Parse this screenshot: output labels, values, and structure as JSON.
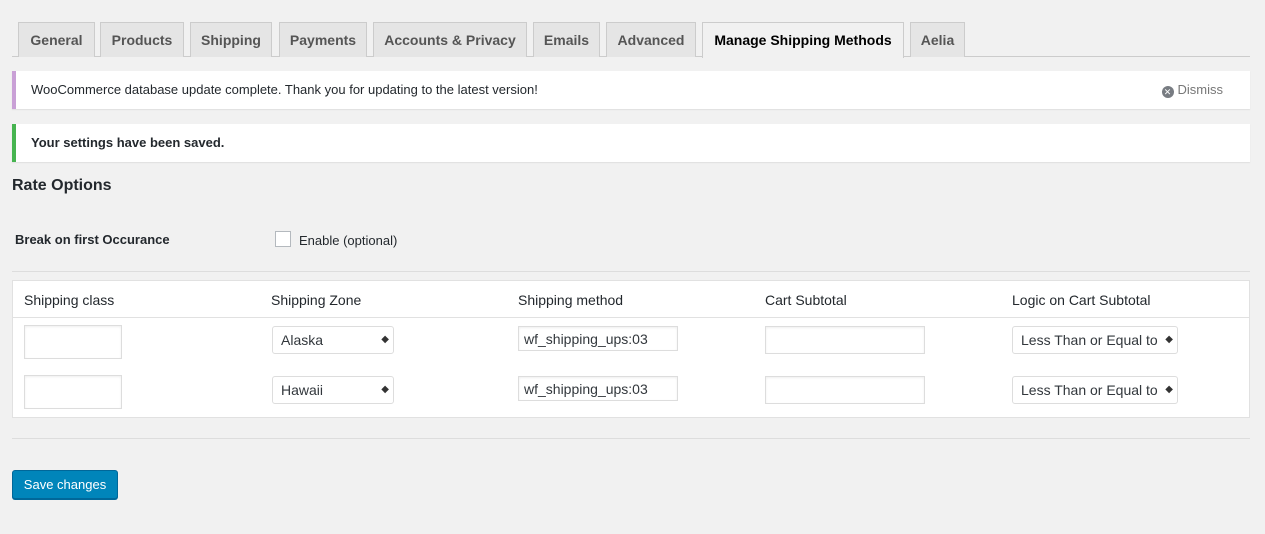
{
  "tabs": [
    "General",
    "Products",
    "Shipping",
    "Payments",
    "Accounts & Privacy",
    "Emails",
    "Advanced",
    "Manage Shipping Methods",
    "Aelia"
  ],
  "notices": {
    "update": "WooCommerce database update complete. Thank you for updating to the latest version!",
    "dismiss": "Dismiss",
    "saved": "Your settings have been saved."
  },
  "section_title": "Rate Options",
  "break_option": {
    "label": "Break on first Occurance",
    "checkbox_label": "Enable (optional)"
  },
  "table": {
    "headers": [
      "Shipping class",
      "Shipping Zone",
      "Shipping method",
      "Cart Subtotal",
      "Logic on Cart Subtotal"
    ],
    "rows": [
      {
        "shipping_class": "",
        "zone": "Alaska",
        "method": "wf_shipping_ups:03",
        "subtotal": "",
        "logic": "Less Than or Equal to"
      },
      {
        "shipping_class": "",
        "zone": "Hawaii",
        "method": "wf_shipping_ups:03",
        "subtotal": "",
        "logic": "Less Than or Equal to"
      }
    ]
  },
  "save_button": "Save changes",
  "colors": {
    "primary": "#0085ba",
    "success": "#46b450",
    "update_notice": "#c9a0d6"
  }
}
